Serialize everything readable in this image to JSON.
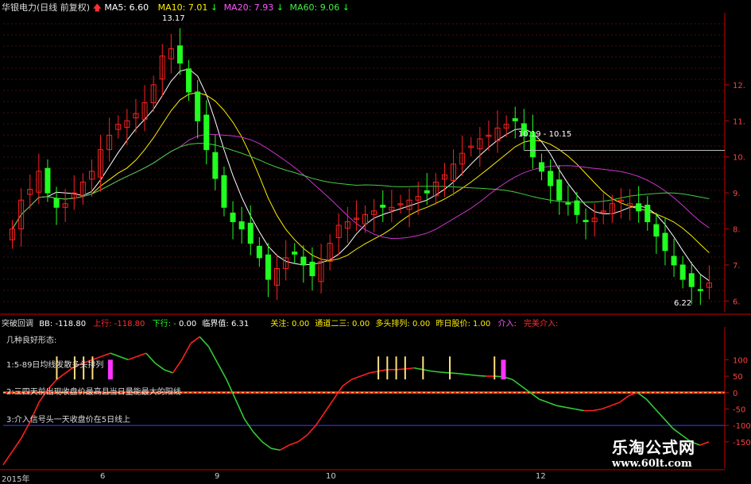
{
  "colors": {
    "background": "#000000",
    "up_candle": "#ff2020",
    "down_candle": "#20ff20",
    "ma5": "#ffffff",
    "ma10": "#ffee00",
    "ma20": "#cc33cc",
    "ma60": "#44cc44",
    "axis_red": "#cc0000",
    "osc_green": "#33cc33",
    "osc_red": "#ff2020",
    "bar_yellow": "#ffe080",
    "bar_magenta": "#ff33ff",
    "blue_line": "#3333ff"
  },
  "top_header": {
    "stock": "华银电力(日线 前复权)",
    "ma5": "MA5: 6.60",
    "ma10": "MA10: 7.01",
    "ma20": "MA20: 7.93",
    "ma60": "MA60: 9.06"
  },
  "indicator_header": {
    "name": "突破回调",
    "bb": "BB: -118.80",
    "up": "上行: -118.80",
    "down": "下行: -",
    "zero": "0.00",
    "critical": "临界值: 6.31",
    "attention": "关注: 0.00",
    "channel": "通道二三: 0.00",
    "bull": "多头排列: 0.00",
    "prev_price": "昨日股价: 1.00",
    "intervene": "介入:",
    "perfect": "完美介入:"
  },
  "indicator_labels": [
    "几种良好形态:",
    "1:5-89日均线发散多头排列",
    "2:三四天前出现收盘价最高且当日量能最大的阳线",
    "3:介入信号头一天收盘价在5日线上"
  ],
  "price_annotations": {
    "high": "13.17",
    "low": "6.22",
    "range": "10.19 - 10.15"
  },
  "x_axis_labels": [
    "2015年",
    "6",
    "9",
    "10",
    "12"
  ],
  "watermark": {
    "line1": "乐淘公式网",
    "line2": "www.60lt.com"
  },
  "chart_data": [
    {
      "type": "candlestick",
      "title": "华银电力(日线 前复权)",
      "y_ticks": [
        6,
        7,
        8,
        9,
        10,
        11,
        12
      ],
      "ylim": [
        5.7,
        14.0
      ],
      "grid": true,
      "series": [
        {
          "name": "MA5",
          "value": 6.6
        },
        {
          "name": "MA10",
          "value": 7.01
        },
        {
          "name": "MA20",
          "value": 7.93
        },
        {
          "name": "MA60",
          "value": 9.06
        }
      ],
      "close_path": [
        8.0,
        8.8,
        9.1,
        9.6,
        9.0,
        8.6,
        8.7,
        9.0,
        9.3,
        9.6,
        10.2,
        10.6,
        10.9,
        11.0,
        11.2,
        11.5,
        12.0,
        12.8,
        13.0,
        12.6,
        11.8,
        11.0,
        10.2,
        9.4,
        8.6,
        8.2,
        8.0,
        7.6,
        7.2,
        6.6,
        6.9,
        7.2,
        7.3,
        7.0,
        6.7,
        7.1,
        7.6,
        8.1,
        8.2,
        8.3,
        8.4,
        8.5,
        8.6,
        8.6,
        8.7,
        8.8,
        8.9,
        9.0,
        9.3,
        9.5,
        9.8,
        10.1,
        10.3,
        10.5,
        10.6,
        10.8,
        10.9,
        11.0,
        10.6,
        10.0,
        9.6,
        9.2,
        8.8,
        8.7,
        8.4,
        8.2,
        8.3,
        8.5,
        8.7,
        8.8,
        8.7,
        8.5,
        8.2,
        7.8,
        7.4,
        7.0,
        6.6,
        6.4,
        6.3,
        6.5
      ],
      "y_tick_labels": [
        "6.",
        "7.",
        "8.",
        "9.",
        "10.",
        "11.",
        "12."
      ]
    },
    {
      "type": "line",
      "title": "突破回调",
      "y_ticks": [
        100,
        50,
        0,
        -50,
        -100,
        -150
      ],
      "y_tick_labels": [
        "100",
        "50",
        "0",
        "-50",
        "-100",
        "-150"
      ],
      "ylim": [
        -230,
        200
      ],
      "grid": false,
      "osc_path": [
        -220,
        -180,
        -140,
        -90,
        -30,
        10,
        40,
        60,
        80,
        90,
        100,
        110,
        120,
        110,
        100,
        110,
        120,
        90,
        70,
        60,
        100,
        150,
        170,
        140,
        90,
        40,
        -20,
        -80,
        -120,
        -150,
        -170,
        -175,
        -160,
        -150,
        -130,
        -100,
        -60,
        -20,
        20,
        40,
        50,
        60,
        65,
        70,
        70,
        72,
        75,
        70,
        65,
        62,
        60,
        58,
        55,
        52,
        50,
        50,
        48,
        40,
        20,
        0,
        -20,
        -30,
        -40,
        -45,
        -50,
        -55,
        -55,
        -50,
        -40,
        -30,
        -10,
        0,
        -20,
        -50,
        -80,
        -110,
        -130,
        -150,
        -160,
        -150
      ],
      "signal_bars_yellow": [
        6,
        8,
        9,
        10,
        42,
        43,
        44,
        45,
        47,
        50,
        55
      ],
      "signal_bars_magenta": [
        12,
        56
      ]
    }
  ]
}
